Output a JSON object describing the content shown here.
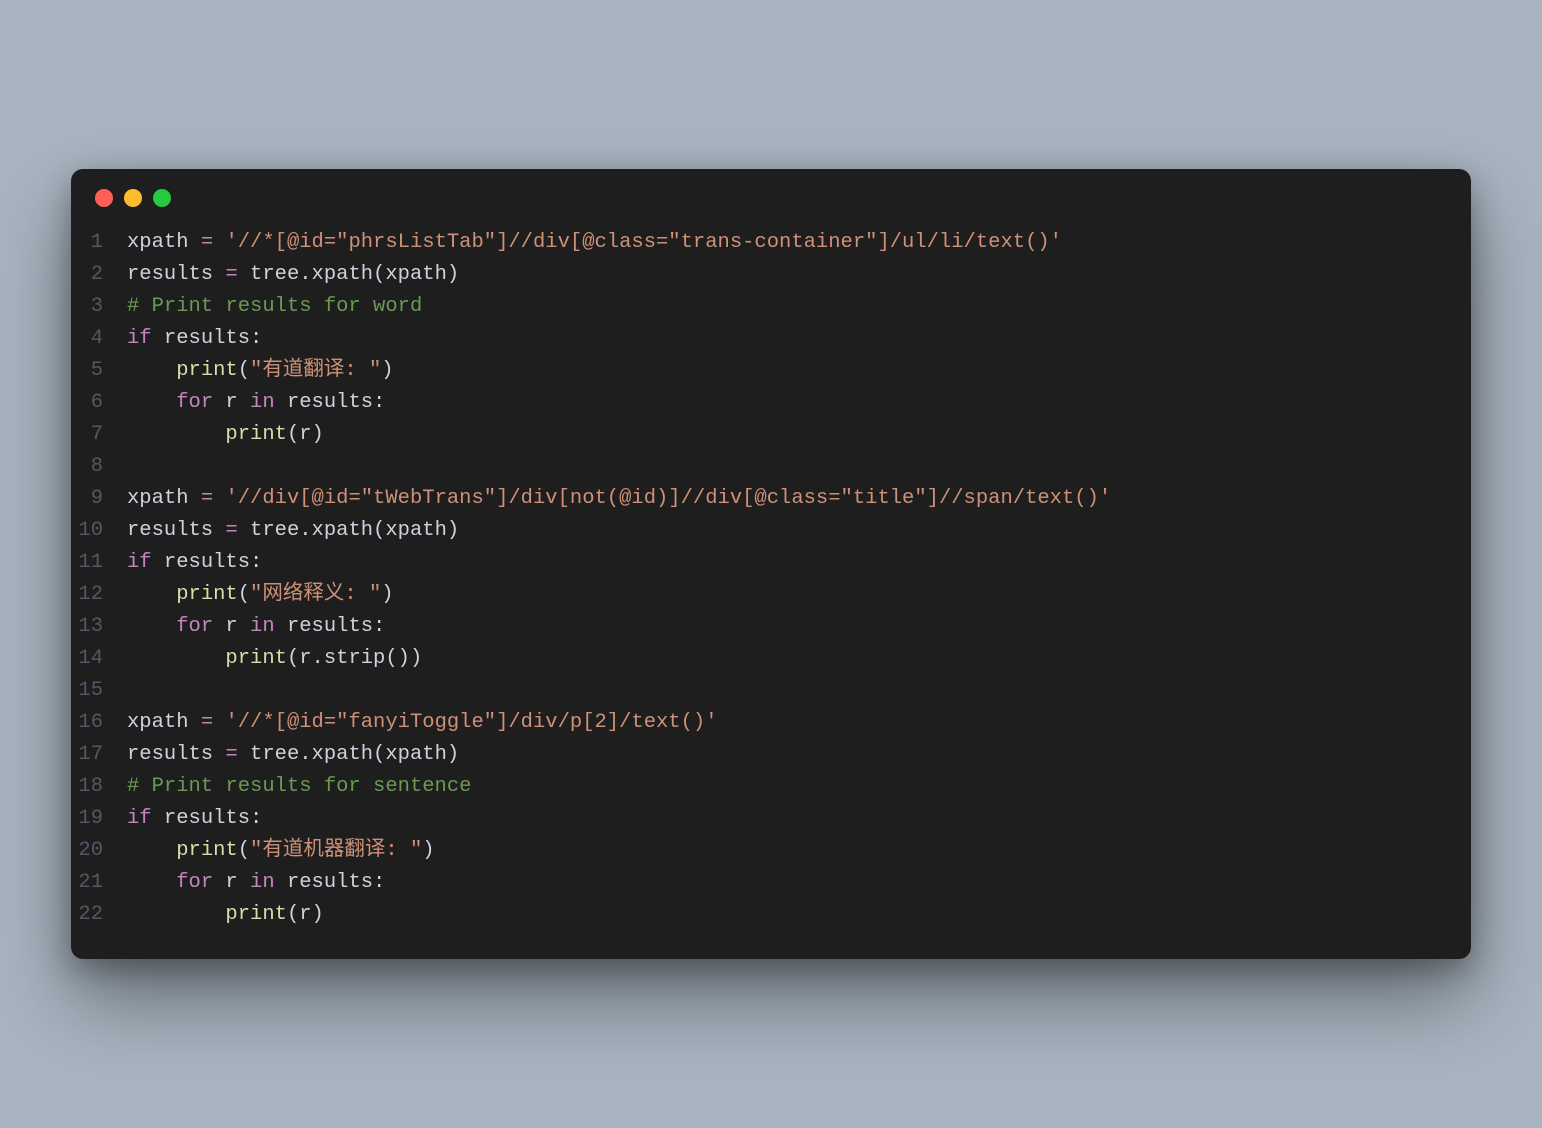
{
  "code": {
    "lines": [
      {
        "num": "1",
        "tokens": [
          {
            "t": "xpath ",
            "c": "tok-name"
          },
          {
            "t": "=",
            "c": "tok-op"
          },
          {
            "t": " ",
            "c": "tok-name"
          },
          {
            "t": "'//*[@id=\"phrsListTab\"]//div[@class=\"trans-container\"]/ul/li/text()'",
            "c": "tok-str"
          }
        ]
      },
      {
        "num": "2",
        "tokens": [
          {
            "t": "results ",
            "c": "tok-name"
          },
          {
            "t": "=",
            "c": "tok-op"
          },
          {
            "t": " tree.xpath(xpath)",
            "c": "tok-name"
          }
        ]
      },
      {
        "num": "3",
        "tokens": [
          {
            "t": "# Print results for word",
            "c": "tok-comment"
          }
        ]
      },
      {
        "num": "4",
        "tokens": [
          {
            "t": "if",
            "c": "tok-kw"
          },
          {
            "t": " results:",
            "c": "tok-name"
          }
        ]
      },
      {
        "num": "5",
        "tokens": [
          {
            "t": "    ",
            "c": "tok-name"
          },
          {
            "t": "print",
            "c": "tok-builtin"
          },
          {
            "t": "(",
            "c": "tok-punct"
          },
          {
            "t": "\"有道翻译: \"",
            "c": "tok-str"
          },
          {
            "t": ")",
            "c": "tok-punct"
          }
        ]
      },
      {
        "num": "6",
        "tokens": [
          {
            "t": "    ",
            "c": "tok-name"
          },
          {
            "t": "for",
            "c": "tok-kw"
          },
          {
            "t": " r ",
            "c": "tok-name"
          },
          {
            "t": "in",
            "c": "tok-kw"
          },
          {
            "t": " results:",
            "c": "tok-name"
          }
        ]
      },
      {
        "num": "7",
        "tokens": [
          {
            "t": "        ",
            "c": "tok-name"
          },
          {
            "t": "print",
            "c": "tok-builtin"
          },
          {
            "t": "(r)",
            "c": "tok-punct"
          }
        ]
      },
      {
        "num": "8",
        "tokens": []
      },
      {
        "num": "9",
        "tokens": [
          {
            "t": "xpath ",
            "c": "tok-name"
          },
          {
            "t": "=",
            "c": "tok-op"
          },
          {
            "t": " ",
            "c": "tok-name"
          },
          {
            "t": "'//div[@id=\"tWebTrans\"]/div[not(@id)]//div[@class=\"title\"]//span/text()'",
            "c": "tok-str"
          }
        ]
      },
      {
        "num": "10",
        "tokens": [
          {
            "t": "results ",
            "c": "tok-name"
          },
          {
            "t": "=",
            "c": "tok-op"
          },
          {
            "t": " tree.xpath(xpath)",
            "c": "tok-name"
          }
        ]
      },
      {
        "num": "11",
        "tokens": [
          {
            "t": "if",
            "c": "tok-kw"
          },
          {
            "t": " results:",
            "c": "tok-name"
          }
        ]
      },
      {
        "num": "12",
        "tokens": [
          {
            "t": "    ",
            "c": "tok-name"
          },
          {
            "t": "print",
            "c": "tok-builtin"
          },
          {
            "t": "(",
            "c": "tok-punct"
          },
          {
            "t": "\"网络释义: \"",
            "c": "tok-str"
          },
          {
            "t": ")",
            "c": "tok-punct"
          }
        ]
      },
      {
        "num": "13",
        "tokens": [
          {
            "t": "    ",
            "c": "tok-name"
          },
          {
            "t": "for",
            "c": "tok-kw"
          },
          {
            "t": " r ",
            "c": "tok-name"
          },
          {
            "t": "in",
            "c": "tok-kw"
          },
          {
            "t": " results:",
            "c": "tok-name"
          }
        ]
      },
      {
        "num": "14",
        "tokens": [
          {
            "t": "        ",
            "c": "tok-name"
          },
          {
            "t": "print",
            "c": "tok-builtin"
          },
          {
            "t": "(r.strip())",
            "c": "tok-punct"
          }
        ]
      },
      {
        "num": "15",
        "tokens": []
      },
      {
        "num": "16",
        "tokens": [
          {
            "t": "xpath ",
            "c": "tok-name"
          },
          {
            "t": "=",
            "c": "tok-op"
          },
          {
            "t": " ",
            "c": "tok-name"
          },
          {
            "t": "'//*[@id=\"fanyiToggle\"]/div/p[2]/text()'",
            "c": "tok-str"
          }
        ]
      },
      {
        "num": "17",
        "tokens": [
          {
            "t": "results ",
            "c": "tok-name"
          },
          {
            "t": "=",
            "c": "tok-op"
          },
          {
            "t": " tree.xpath(xpath)",
            "c": "tok-name"
          }
        ]
      },
      {
        "num": "18",
        "tokens": [
          {
            "t": "# Print results for sentence",
            "c": "tok-comment"
          }
        ]
      },
      {
        "num": "19",
        "tokens": [
          {
            "t": "if",
            "c": "tok-kw"
          },
          {
            "t": " results:",
            "c": "tok-name"
          }
        ]
      },
      {
        "num": "20",
        "tokens": [
          {
            "t": "    ",
            "c": "tok-name"
          },
          {
            "t": "print",
            "c": "tok-builtin"
          },
          {
            "t": "(",
            "c": "tok-punct"
          },
          {
            "t": "\"有道机器翻译: \"",
            "c": "tok-str"
          },
          {
            "t": ")",
            "c": "tok-punct"
          }
        ]
      },
      {
        "num": "21",
        "tokens": [
          {
            "t": "    ",
            "c": "tok-name"
          },
          {
            "t": "for",
            "c": "tok-kw"
          },
          {
            "t": " r ",
            "c": "tok-name"
          },
          {
            "t": "in",
            "c": "tok-kw"
          },
          {
            "t": " results:",
            "c": "tok-name"
          }
        ]
      },
      {
        "num": "22",
        "tokens": [
          {
            "t": "        ",
            "c": "tok-name"
          },
          {
            "t": "print",
            "c": "tok-builtin"
          },
          {
            "t": "(r)",
            "c": "tok-punct"
          }
        ]
      }
    ]
  }
}
